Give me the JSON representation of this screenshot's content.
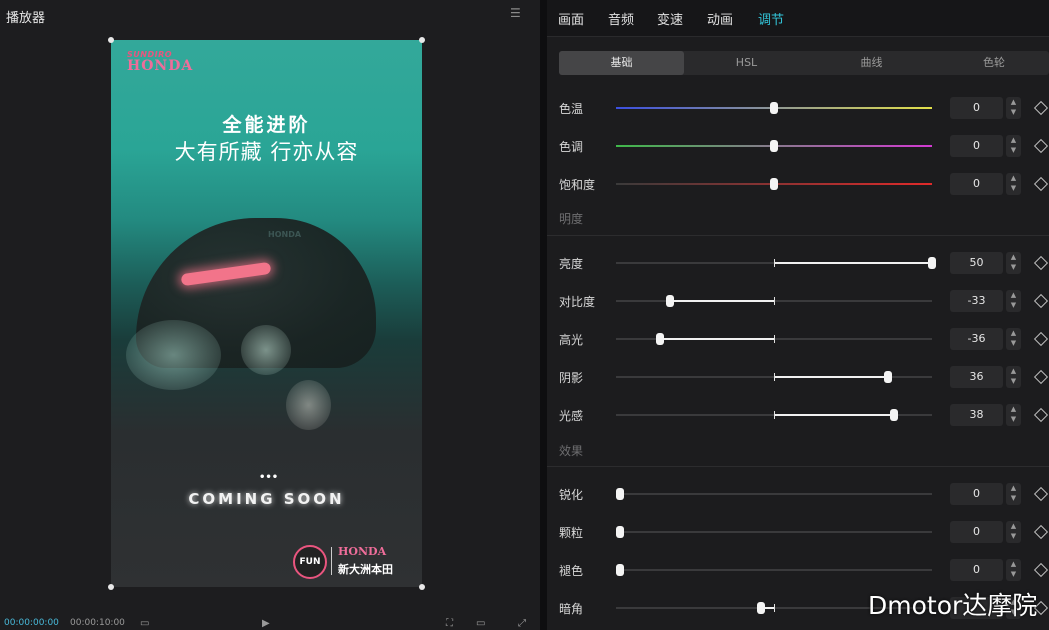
{
  "player": {
    "title": "播放器",
    "menu_icon": "menu-icon",
    "poster": {
      "brand_small": "SUNDIRO",
      "brand_honda": "HONDA",
      "headline1": "全能进阶",
      "headline2": "大有所藏 行亦从容",
      "bike_logo": "HONDA",
      "dots": "•••",
      "coming": "COMING SOON",
      "fun": "FUN",
      "bottom_honda": "HONDA",
      "bottom_cn": "新大洲本田"
    },
    "time_current": "00:00:00:00",
    "time_total": "00:00:10:00"
  },
  "tabs": [
    {
      "label": "画面",
      "active": false
    },
    {
      "label": "音频",
      "active": false
    },
    {
      "label": "变速",
      "active": false
    },
    {
      "label": "动画",
      "active": false
    },
    {
      "label": "调节",
      "active": true
    }
  ],
  "subtabs": [
    {
      "label": "基础",
      "active": true
    },
    {
      "label": "HSL",
      "active": false
    },
    {
      "label": "曲线",
      "active": false
    },
    {
      "label": "色轮",
      "active": false
    }
  ],
  "color_rows": [
    {
      "label": "色温",
      "value": "0",
      "gradient": [
        "#3b4fe0",
        "#e3e04a"
      ]
    },
    {
      "label": "色调",
      "value": "0",
      "gradient": [
        "#3fb84a",
        "#d23ad2"
      ]
    },
    {
      "label": "饱和度",
      "value": "0",
      "gradient": [
        "#3a3a3a",
        "#e02a2a"
      ]
    }
  ],
  "section_brightness": "明度",
  "brightness_rows": [
    {
      "label": "亮度",
      "value": "50",
      "level": 50
    },
    {
      "label": "对比度",
      "value": "-33",
      "level": -33
    },
    {
      "label": "高光",
      "value": "-36",
      "level": -36
    },
    {
      "label": "阴影",
      "value": "36",
      "level": 36
    },
    {
      "label": "光感",
      "value": "38",
      "level": 38
    }
  ],
  "section_effect": "效果",
  "effect_rows": [
    {
      "label": "锐化",
      "value": "0",
      "level": 0
    },
    {
      "label": "颗粒",
      "value": "0",
      "level": 0
    },
    {
      "label": "褪色",
      "value": "0",
      "level": 0
    },
    {
      "label": "暗角",
      "value": "",
      "level": -4
    }
  ],
  "watermark": "Dmotor达摩院",
  "accent_color": "#32c4d8"
}
